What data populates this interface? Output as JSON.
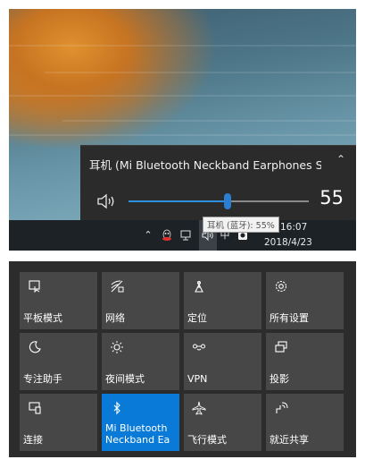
{
  "volume_flyout": {
    "device_name": "耳机 (Mi Bluetooth Neckband Earphones Ster...",
    "volume_value": "55",
    "volume_level": 55
  },
  "taskbar": {
    "tooltip": "耳机 (蓝牙): 55%",
    "ime_label": "中",
    "time": "16:07",
    "date": "2018/4/23"
  },
  "action_center": {
    "tiles": [
      {
        "label": "平板模式",
        "icon": "tablet-mode-icon",
        "active": false
      },
      {
        "label": "网络",
        "icon": "network-icon",
        "active": false
      },
      {
        "label": "定位",
        "icon": "location-icon",
        "active": false
      },
      {
        "label": "所有设置",
        "icon": "gear-icon",
        "active": false
      },
      {
        "label": "专注助手",
        "icon": "moon-icon",
        "active": false
      },
      {
        "label": "夜间模式",
        "icon": "brightness-icon",
        "active": false
      },
      {
        "label": "VPN",
        "icon": "vpn-icon",
        "active": false
      },
      {
        "label": "投影",
        "icon": "project-icon",
        "active": false
      },
      {
        "label": "连接",
        "icon": "connect-icon",
        "active": false
      },
      {
        "label": "Mi Bluetooth\nNeckband Ea",
        "icon": "bluetooth-icon",
        "active": true
      },
      {
        "label": "飞行模式",
        "icon": "airplane-icon",
        "active": false
      },
      {
        "label": "就近共享",
        "icon": "nearby-share-icon",
        "active": false
      }
    ]
  },
  "colors": {
    "accent": "#0a7ad8",
    "tile": "#474747",
    "flyout": "#2b2b2b"
  }
}
